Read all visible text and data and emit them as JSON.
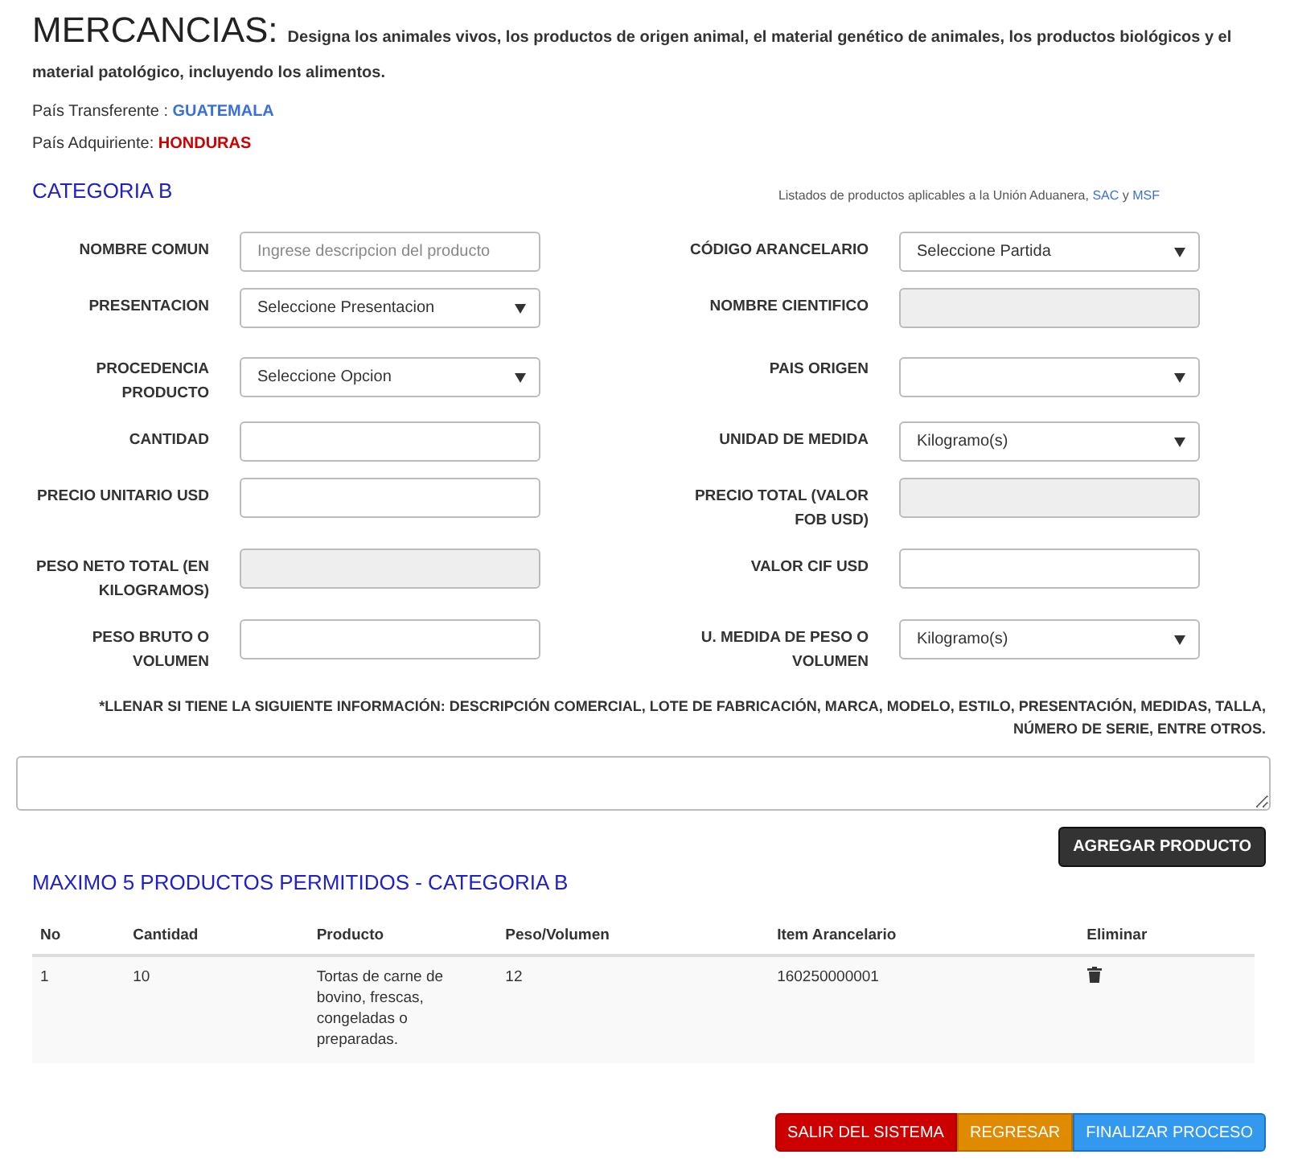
{
  "header": {
    "title": "MERCANCIAS:",
    "description": "Designa los animales vivos, los productos de origen animal, el material genético de animales, los productos biológicos y el material patológico, incluyendo los alimentos."
  },
  "countries": [
    {
      "label": "País Transferente : ",
      "value": "GUATEMALA",
      "color": "#3a6fd8"
    },
    {
      "label": "País Adquiriente: ",
      "value": "HONDURAS",
      "color": "#cc0000"
    }
  ],
  "category": {
    "title": "CATEGORIA B",
    "links_text": "Listados de productos aplicables a la Unión Aduanera, ",
    "link_sac": "SAC",
    "link_and": " y ",
    "link_msf": "MSF"
  },
  "fields": [
    {
      "label": "NOMBRE COMUN",
      "kind": "text",
      "placeholder": "Ingrese descripcion del producto"
    },
    {
      "label": "CÓDIGO ARANCELARIO",
      "kind": "select",
      "value": "Seleccione Partida"
    },
    {
      "label": "PRESENTACION",
      "kind": "select",
      "value": "Seleccione Presentacion"
    },
    {
      "label": "NOMBRE CIENTIFICO",
      "kind": "disabled"
    },
    {
      "label": "PROCEDENCIA PRODUCTO",
      "kind": "select",
      "value": "Seleccione Opcion"
    },
    {
      "label": "PAIS ORIGEN",
      "kind": "select"
    },
    {
      "label": "CANTIDAD",
      "kind": "text"
    },
    {
      "label": "UNIDAD DE MEDIDA",
      "kind": "select",
      "value": "Kilogramo(s)"
    },
    {
      "label": "PRECIO UNITARIO USD",
      "kind": "text"
    },
    {
      "label": "PRECIO TOTAL (VALOR FOB USD)",
      "kind": "disabled"
    },
    {
      "label": "PESO NETO TOTAL (EN KILOGRAMOS)",
      "kind": "disabled"
    },
    {
      "label": "VALOR CIF USD",
      "kind": "text"
    },
    {
      "label": "PESO BRUTO O VOLUMEN",
      "kind": "text"
    },
    {
      "label": "U. MEDIDA DE PESO O VOLUMEN",
      "kind": "select",
      "value": "Kilogramo(s)"
    }
  ],
  "note": "*LLENAR SI TIENE LA SIGUIENTE INFORMACIÓN: DESCRIPCIÓN COMERCIAL, LOTE DE FABRICACIÓN, MARCA, MODELO, ESTILO, PRESENTACIÓN, MEDIDAS, TALLA, NÚMERO DE SERIE, ENTRE OTROS.",
  "add_button": "AGREGAR PRODUCTO",
  "table": {
    "title": "MAXIMO 5 PRODUCTOS PERMITIDOS - CATEGORIA B",
    "columns": [
      "No",
      "Cantidad",
      "Producto",
      "Peso/Volumen",
      "Item Arancelario",
      "Eliminar"
    ],
    "rows": [
      [
        "1",
        "10",
        "Tortas de carne de bovino, frescas, congeladas o preparadas.",
        "12",
        "160250000001"
      ]
    ]
  },
  "buttons": [
    {
      "label": "SALIR DEL SISTEMA",
      "kind": "danger"
    },
    {
      "label": "REGRESAR",
      "kind": "warning"
    },
    {
      "label": "FINALIZAR PROCESO",
      "kind": "primary"
    }
  ]
}
